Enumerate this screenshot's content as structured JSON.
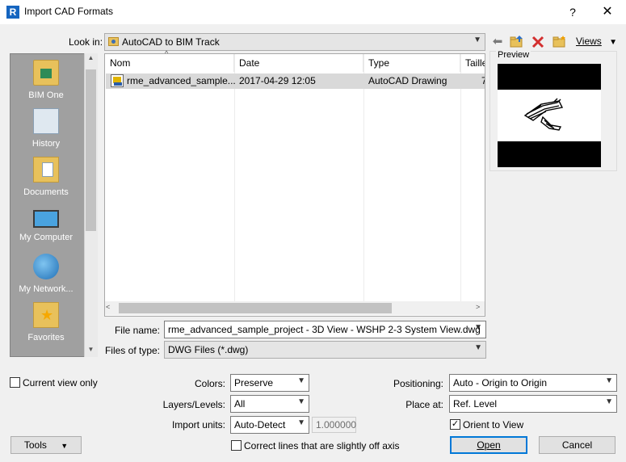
{
  "window": {
    "app_icon_letter": "R",
    "title": "Import CAD Formats",
    "help_glyph": "?",
    "close_glyph": "✕"
  },
  "look_in": {
    "label": "Look in:",
    "value": "AutoCAD to BIM Track",
    "views_label": "Views"
  },
  "places": [
    {
      "label": "BIM One",
      "icon": "bim-one-folder-icon"
    },
    {
      "label": "History",
      "icon": "history-icon"
    },
    {
      "label": "Documents",
      "icon": "documents-icon"
    },
    {
      "label": "My Computer",
      "icon": "computer-icon"
    },
    {
      "label": "My Network...",
      "icon": "network-icon"
    },
    {
      "label": "Favorites",
      "icon": "favorites-icon"
    }
  ],
  "file_list": {
    "columns": [
      "Nom",
      "Date",
      "Type",
      "Taille"
    ],
    "rows": [
      {
        "name": "rme_advanced_sample...",
        "date": "2017-04-29 12:05",
        "type": "AutoCAD Drawing",
        "size": "7"
      }
    ]
  },
  "preview": {
    "label": "Preview"
  },
  "file_name": {
    "label": "File name:",
    "value": "rme_advanced_sample_project - 3D View - WSHP 2-3 System View.dwg"
  },
  "files_of_type": {
    "label": "Files of type:",
    "value": "DWG Files  (*.dwg)"
  },
  "options": {
    "current_view_only": {
      "label": "Current view only",
      "checked": false
    },
    "colors": {
      "label": "Colors:",
      "value": "Preserve"
    },
    "layers": {
      "label": "Layers/Levels:",
      "value": "All"
    },
    "import_units": {
      "label": "Import units:",
      "value": "Auto-Detect",
      "scale": "1.000000"
    },
    "correct_lines": {
      "label": "Correct lines that are slightly off axis",
      "checked": false
    },
    "positioning": {
      "label": "Positioning:",
      "value": "Auto - Origin to Origin"
    },
    "place_at": {
      "label": "Place at:",
      "value": "Ref. Level"
    },
    "orient_to_view": {
      "label": "Orient to View",
      "checked": true
    }
  },
  "buttons": {
    "tools": "Tools",
    "open": "Open",
    "cancel": "Cancel"
  }
}
